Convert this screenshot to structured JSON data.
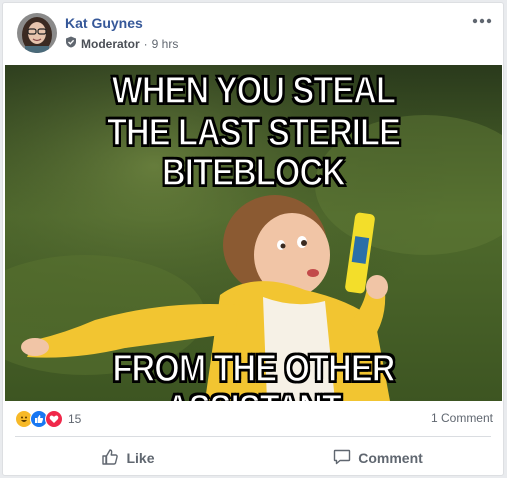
{
  "post": {
    "author": "Kat Guynes",
    "role": "Moderator",
    "separator": "·",
    "time": "9 hrs"
  },
  "meme": {
    "line1": "WHEN YOU STEAL",
    "line2": "THE LAST STERILE BITEBLOCK",
    "line3": "FROM THE OTHER ASSISTANT"
  },
  "stats": {
    "reaction_icons": [
      "haha-icon",
      "like-icon",
      "love-icon"
    ],
    "reaction_count": "15",
    "comment_count": "1 Comment"
  },
  "actions": {
    "like": "Like",
    "comment": "Comment"
  },
  "colors": {
    "author": "#365899",
    "like_blue": "#1877f2",
    "love_red": "#f0284a",
    "haha_yellow": "#f7b928"
  }
}
